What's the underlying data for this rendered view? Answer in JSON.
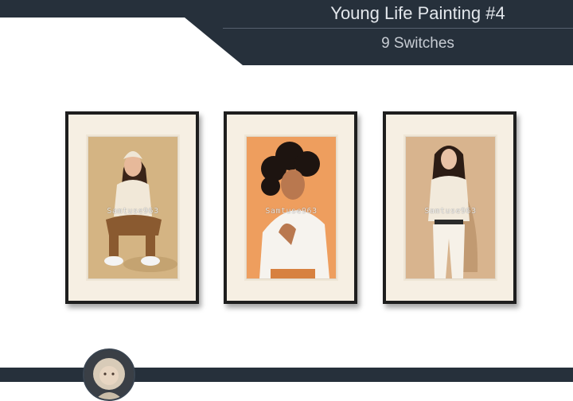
{
  "header": {
    "title": "Young Life Painting #4",
    "subtitle": "9 Switches"
  },
  "paintings": [
    {
      "watermark": "Samtuse963",
      "background": "#d4b483",
      "description_icon": "woman-sitting-icon"
    },
    {
      "watermark": "Samtuse963",
      "background": "#ee9e5e",
      "description_icon": "woman-curly-hair-icon"
    },
    {
      "watermark": "Samtuse963",
      "background": "#d8b48e",
      "description_icon": "woman-standing-icon"
    }
  ],
  "colors": {
    "banner": "#26303b",
    "frame": "#1e1e1e",
    "mat": "#f6efe3"
  }
}
